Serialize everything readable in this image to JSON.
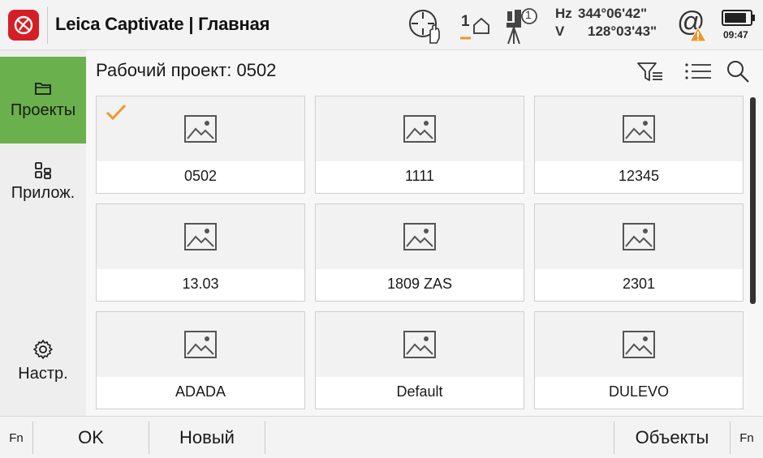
{
  "header": {
    "app_title": "Leica Captivate | Главная",
    "target_badge": "1",
    "instrument_badge": "1",
    "hz_label": "Hz",
    "hz_value": "344°06'42\"",
    "v_label": "V",
    "v_value": "128°03'43\"",
    "battery_time": "09:47",
    "icons": [
      "leica-logo-icon",
      "crosshair-hand-icon",
      "target-home-icon",
      "instrument-icon",
      "at-warning-icon",
      "battery-icon"
    ]
  },
  "sidebar": {
    "items": [
      {
        "label": "Проекты",
        "icon": "folder-icon",
        "active": true
      },
      {
        "label": "Прилож.",
        "icon": "apps-icon",
        "active": false
      },
      {
        "label": "Настр.",
        "icon": "gear-icon",
        "active": false
      }
    ]
  },
  "main": {
    "title": "Рабочий проект: 0502",
    "tools": [
      "filter-icon",
      "list-view-icon",
      "search-icon"
    ],
    "projects": [
      {
        "name": "0502",
        "selected": true
      },
      {
        "name": "1111",
        "selected": false
      },
      {
        "name": "12345",
        "selected": false
      },
      {
        "name": "13.03",
        "selected": false
      },
      {
        "name": "1809 ZAS",
        "selected": false
      },
      {
        "name": "2301",
        "selected": false
      },
      {
        "name": "ADADA",
        "selected": false
      },
      {
        "name": "Default",
        "selected": false
      },
      {
        "name": "DULEVO",
        "selected": false
      }
    ]
  },
  "footer": {
    "fn_left": "Fn",
    "ok": "OK",
    "new": "Новый",
    "objects": "Объекты",
    "fn_right": "Fn"
  },
  "colors": {
    "accent_green": "#6ab04c",
    "brand_red": "#d41f26",
    "check_orange": "#f0962a",
    "warning_orange": "#f0962a"
  }
}
